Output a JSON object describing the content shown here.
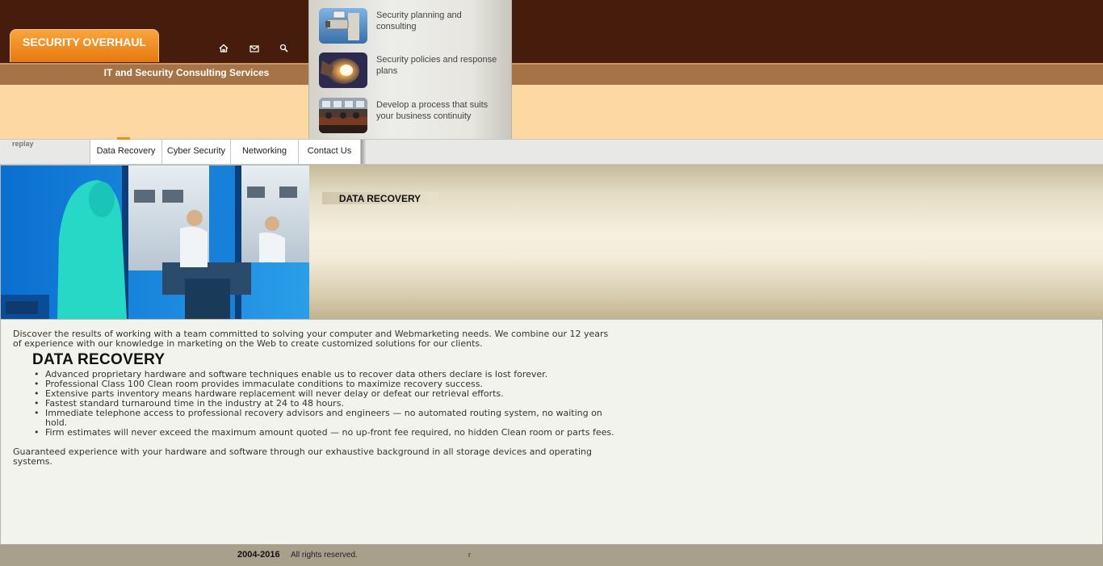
{
  "header": {
    "logo_text": "SECURITY OVERHAUL",
    "tagline": "IT and Security Consulting Services",
    "icons": [
      "home-icon",
      "mail-icon",
      "search-icon"
    ]
  },
  "dropdown": {
    "items": [
      {
        "label": "Security planning and consulting",
        "icon": "security-camera-image"
      },
      {
        "label": "Security policies and response plans",
        "icon": "flashlight-image"
      },
      {
        "label": "Develop a process that suits your business continuity",
        "icon": "control-room-image"
      }
    ]
  },
  "nav": {
    "replay": "replay",
    "items": [
      "Data Recovery",
      "Cyber Security",
      "Networking",
      "Contact Us"
    ]
  },
  "hero": {
    "label": "DATA RECOVERY"
  },
  "content": {
    "intro": "Discover the results of working with a team committed to solving your computer and Webmarketing needs.  We combine our 12 years of experience with our knowledge in marketing on the Web to create customized solutions for our clients.",
    "title": "DATA RECOVERY",
    "features": [
      "Advanced proprietary hardware and software techniques enable us to recover data others declare is lost forever.",
      "Professional Class 100 Clean room provides immaculate conditions to maximize recovery success.",
      "Extensive parts inventory means hardware replacement will never delay or defeat our retrieval efforts.",
      "Fastest standard turnaround time in the industry at 24 to 48 hours.",
      "Immediate telephone access to professional recovery advisors and engineers — no automated routing system, no waiting on hold.",
      "Firm estimates will never exceed the maximum amount quoted — no up-front fee required, no hidden Clean room or parts fees."
    ],
    "closing": "Guaranteed experience with your hardware and software through our exhaustive background in all storage devices and operating systems."
  },
  "footer": {
    "years": "2004-2016",
    "rights": "All rights reserved.",
    "mark": "r"
  },
  "colors": {
    "header_dark": "#461c0c",
    "accent_orange": "#e77810",
    "subbar": "#a57346",
    "peach": "#fed8a3",
    "footer": "#a8a08a"
  }
}
